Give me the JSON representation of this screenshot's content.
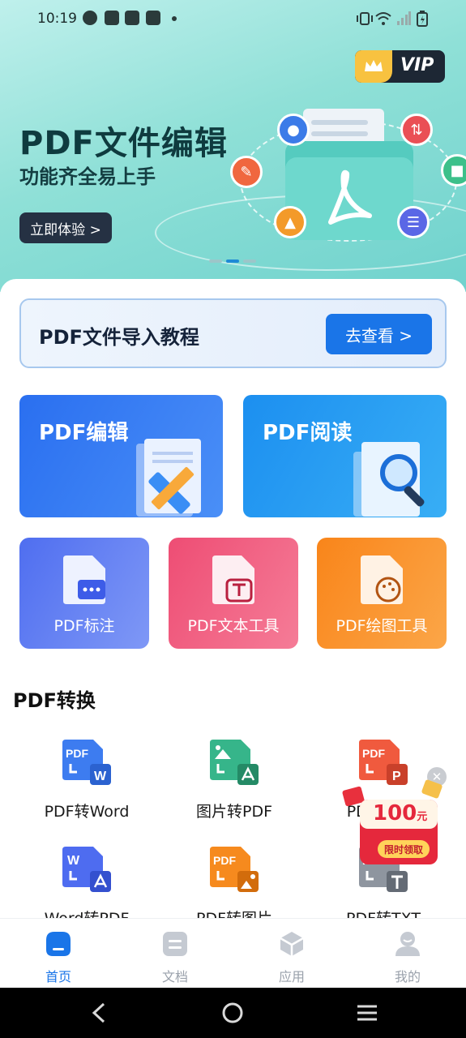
{
  "status_bar": {
    "time": "10:19"
  },
  "vip_badge": {
    "label": "VIP"
  },
  "hero": {
    "title": "PDF文件编辑",
    "subtitle": "功能齐全易上手",
    "cta_label": "立即体验 >"
  },
  "tutorial": {
    "title": "PDF文件导入教程",
    "button_label": "去查看 >"
  },
  "feature_cards": {
    "edit": "PDF编辑",
    "read": "PDF阅读"
  },
  "tool_cards": {
    "annotate": "PDF标注",
    "text_tool": "PDF文本工具",
    "draw_tool": "PDF绘图工具"
  },
  "conversion": {
    "section_title": "PDF转换",
    "items": [
      {
        "label": "PDF转Word",
        "icon": "pdf-to-word-icon"
      },
      {
        "label": "图片转PDF",
        "icon": "image-to-pdf-icon"
      },
      {
        "label": "PDF转PPT",
        "icon": "pdf-to-ppt-icon"
      },
      {
        "label": "Word转PDF",
        "icon": "word-to-pdf-icon"
      },
      {
        "label": "PDF转图片",
        "icon": "pdf-to-image-icon"
      },
      {
        "label": "PDF转TXT",
        "icon": "pdf-to-txt-icon"
      }
    ]
  },
  "promo": {
    "amount": "100",
    "unit": "元",
    "button": "限时领取"
  },
  "bottom_nav": {
    "items": [
      {
        "label": "首页",
        "active": true
      },
      {
        "label": "文档",
        "active": false
      },
      {
        "label": "应用",
        "active": false
      },
      {
        "label": "我的",
        "active": false
      }
    ]
  },
  "colors": {
    "accent": "#1a75e8",
    "hero_bg": "#8fe0d7",
    "edit_card": "#2a6ff0",
    "read_card": "#1c8ff0",
    "annot_card": "#4f6ef0",
    "text_card": "#ee4d74",
    "draw_card": "#f9851a"
  }
}
